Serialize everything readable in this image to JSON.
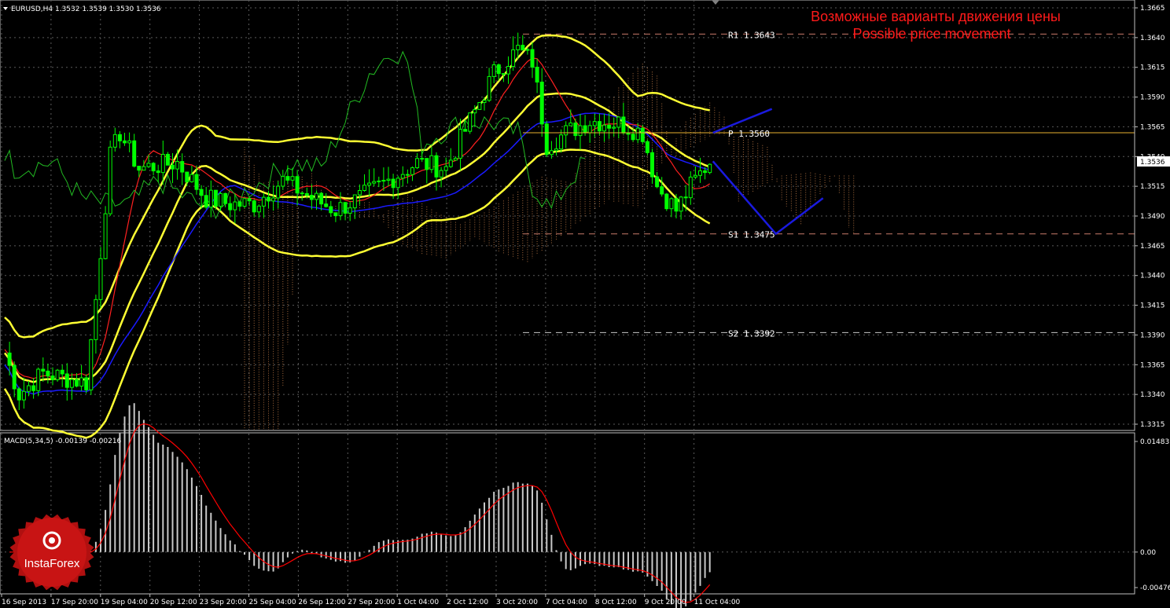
{
  "symbol_header": "EURUSD,H4  1.3532 1.3539 1.3530 1.3536",
  "macd_header": "MACD(5,34,5) -0.00139 -0.00216",
  "title_ru": "Возможные варианты движения цены",
  "title_en": "Possible price movement",
  "levels": [
    {
      "label": "R1 1.3643",
      "value": 1.3643,
      "color": "#c87a6a"
    },
    {
      "label": "P 1.3560",
      "value": 1.356,
      "color": "#e8b030"
    },
    {
      "label": "S1 1.3475",
      "value": 1.3475,
      "color": "#c87a6a"
    },
    {
      "label": "S2 1.3392",
      "value": 1.3392,
      "color": "#c8c8c8"
    }
  ],
  "current_price": "1.3536",
  "logo_text": "InstaForex",
  "colors": {
    "bull": "#00ff00",
    "bear": "#ffffff",
    "bollinger": "#ffff33",
    "kijun": "#1a1aff",
    "tenkan": "#ff2020",
    "projection": "#1a1adf",
    "macd_hist": "#c8c8c8",
    "macd_signal": "#ff0000"
  },
  "chart_data": {
    "type": "line",
    "price_axis": {
      "min": 1.3315,
      "max": 1.3665,
      "ticks": [
        "1.3665",
        "1.3640",
        "1.3615",
        "1.3590",
        "1.3565",
        "1.3540",
        "1.3515",
        "1.3490",
        "1.3465",
        "1.3440",
        "1.3415",
        "1.3390",
        "1.3365",
        "1.3340",
        "1.3315"
      ]
    },
    "time_axis": [
      "16 Sep 2013",
      "17 Sep 20:00",
      "19 Sep 04:00",
      "20 Sep 12:00",
      "23 Sep 20:00",
      "25 Sep 04:00",
      "26 Sep 12:00",
      "27 Sep 20:00",
      "1 Oct 04:00",
      "2 Oct 12:00",
      "3 Oct 20:00",
      "7 Oct 04:00",
      "8 Oct 12:00",
      "9 Oct 20:00",
      "11 Oct 04:00"
    ],
    "macd_axis": {
      "min": -0.00476,
      "max": 0.01483,
      "ticks": [
        "0.01483",
        "0.00",
        "-0.00476"
      ]
    },
    "projection": [
      {
        "x": "11 Oct 04:00",
        "y": 1.356
      },
      {
        "x": "after 11 Oct",
        "y": 1.358
      }
    ],
    "projection_alt": [
      {
        "x": "11 Oct 04:00",
        "y": 1.3536
      },
      {
        "x": "after 11 Oct",
        "y": 1.3475
      },
      {
        "x": "after 11 Oct",
        "y": 1.3505
      }
    ]
  }
}
